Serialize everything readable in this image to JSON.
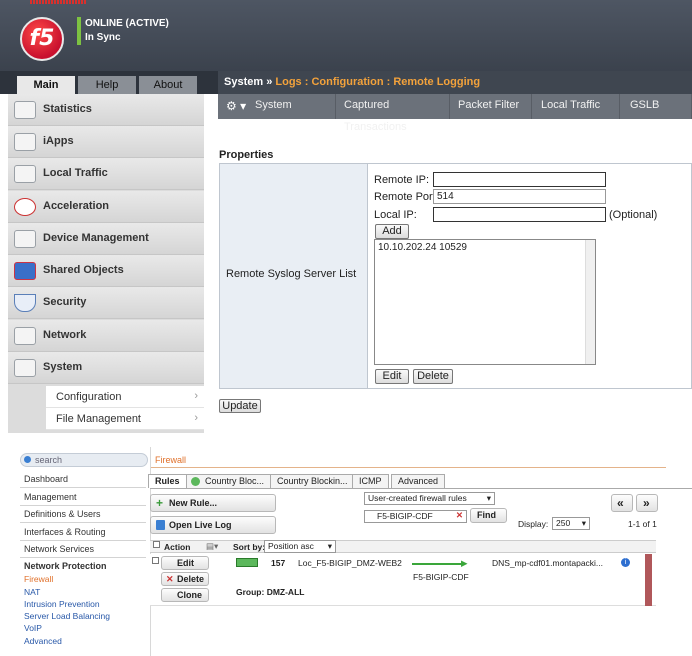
{
  "status": {
    "line1": "ONLINE (ACTIVE)",
    "line2": "In Sync"
  },
  "logo_text": "f5",
  "nav_tabs": [
    "Main",
    "Help",
    "About"
  ],
  "menu": [
    "Statistics",
    "iApps",
    "Local Traffic",
    "Acceleration",
    "Device Management",
    "Shared Objects",
    "Security",
    "Network",
    "System"
  ],
  "submenu": [
    "Configuration",
    "File Management"
  ],
  "breadcrumb": {
    "root": "System",
    "sep": "»",
    "path": "Logs : Configuration : Remote Logging"
  },
  "tabs": [
    "System",
    "Captured Transactions",
    "Packet Filter",
    "Local Traffic",
    "GSLB"
  ],
  "properties_title": "Properties",
  "form": {
    "row_label": "Remote Syslog Server List",
    "remote_ip_label": "Remote IP:",
    "remote_ip_value": "",
    "remote_port_label": "Remote Port:",
    "remote_port_value": "514",
    "local_ip_label": "Local IP:",
    "local_ip_value": "",
    "optional": "(Optional)",
    "add": "Add",
    "list_entry": "10.10.202.24 10529",
    "edit": "Edit",
    "delete": "Delete",
    "update": "Update"
  },
  "bottom": {
    "search_placeholder": "search",
    "title": "Firewall",
    "left_nav": [
      "Dashboard",
      "Management",
      "Definitions & Users",
      "Interfaces & Routing",
      "Network Services",
      "Network Protection"
    ],
    "left_sub": [
      "Firewall",
      "NAT",
      "Intrusion Prevention",
      "Server Load Balancing",
      "VoIP",
      "Advanced"
    ],
    "tabs": [
      "Rules",
      "Country Bloc...",
      "Country Blockin...",
      "ICMP",
      "Advanced"
    ],
    "new_rule": "New Rule...",
    "open_live_log": "Open Live Log",
    "filter_select": "User-created firewall rules",
    "filter_input": "F5-BIGIP-CDF",
    "find": "Find",
    "display_label": "Display:",
    "display_value": "250",
    "pager": "1-1 of 1",
    "prev": "«",
    "next": "»",
    "col_action": "Action",
    "sort_by_label": "Sort by:",
    "sort_by_value": "Position asc",
    "row_edit": "Edit",
    "row_delete": "Delete",
    "row_clone": "Clone",
    "rule_number": "157",
    "rule_source": "Loc_F5-BIGIP_DMZ-WEB2",
    "rule_service": "F5-BIGIP-CDF",
    "rule_dest": "DNS_mp-cdf01.montapacki...",
    "group": "Group: DMZ-ALL"
  },
  "colors": {
    "accent_orange": "#f3a23b",
    "status_green": "#7dc242",
    "brand_red": "#c8102e"
  }
}
